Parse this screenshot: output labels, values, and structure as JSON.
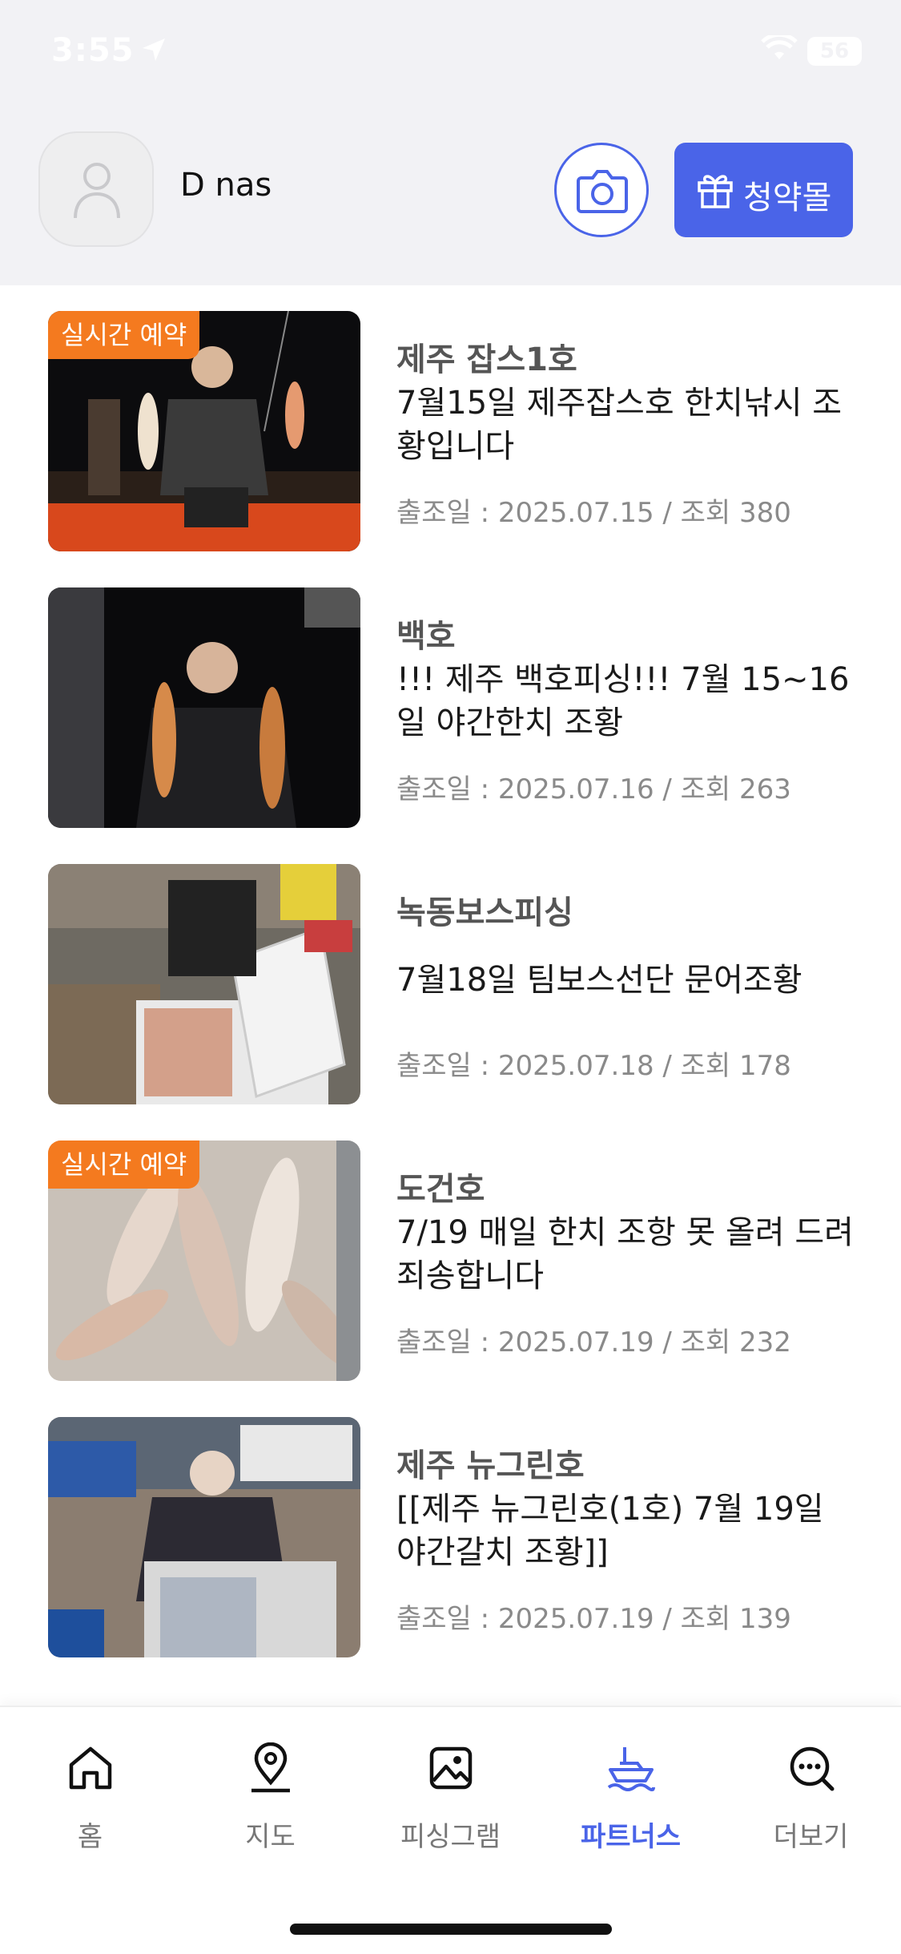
{
  "status": {
    "time": "3:55",
    "battery": "56"
  },
  "header": {
    "user_name": "D nas",
    "shop_label": "청약몰"
  },
  "posts": [
    {
      "badge": "실시간 예약",
      "title": "제주 잡스1호",
      "desc": "7월15일 제주잡스호 한치낚시 조황입니다",
      "meta": "출조일 : 2025.07.15 / 조회 380"
    },
    {
      "badge": "",
      "title": "백호",
      "desc": "!!! 제주 백호피싱!!! 7월 15~16일 야간한치 조황",
      "meta": "출조일 : 2025.07.16 / 조회 263"
    },
    {
      "badge": "",
      "title": "녹동보스피싱",
      "desc": "7월18일 팀보스선단 문어조황",
      "meta": "출조일 : 2025.07.18 / 조회 178"
    },
    {
      "badge": "실시간 예약",
      "title": "도건호",
      "desc": "7/19 매일 한치 조항 못 올려 드려 죄송합니다",
      "meta": "출조일 : 2025.07.19 / 조회 232"
    },
    {
      "badge": "",
      "title": "제주 뉴그린호",
      "desc": "[[제주 뉴그린호(1호) 7월 19일 야간갈치 조황]]",
      "meta": "출조일 : 2025.07.19 / 조회 139"
    }
  ],
  "tabs": [
    {
      "label": "홈",
      "icon": "home-icon"
    },
    {
      "label": "지도",
      "icon": "map-pin-icon"
    },
    {
      "label": "피싱그램",
      "icon": "gallery-icon"
    },
    {
      "label": "파트너스",
      "icon": "boat-icon",
      "active": true
    },
    {
      "label": "더보기",
      "icon": "more-search-icon"
    }
  ],
  "colors": {
    "accent": "#4a64e8",
    "badge": "#f47a1f",
    "header_bg": "#f2f2f5"
  }
}
